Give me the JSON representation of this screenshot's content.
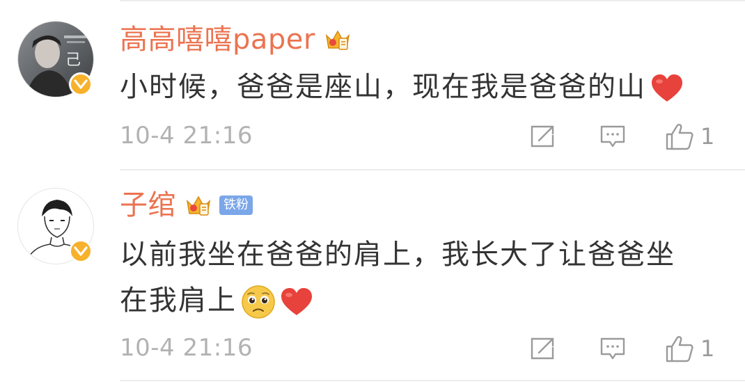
{
  "comments": [
    {
      "username": "高高嘻嘻paper",
      "badge": "",
      "text": "小时候，爸爸是座山，现在我是爸爸的山",
      "timestamp": "10-4 21:16",
      "like_count": "1",
      "emojis": [
        "heart-emoji"
      ]
    },
    {
      "username": "子绾",
      "badge": "铁粉",
      "text_line1": "以前我坐在爸爸的肩上，我长大了让爸爸坐",
      "text_line2": "在我肩上",
      "timestamp": "10-4 21:16",
      "like_count": "1",
      "emojis": [
        "pleading-face-emoji",
        "heart-emoji"
      ]
    }
  ],
  "icons": [
    "verified-icon",
    "crown-icon",
    "share-icon",
    "comment-icon",
    "like-icon"
  ],
  "colors": {
    "username": "#eb7350",
    "text": "#333333",
    "meta": "#b2b2b2",
    "verified": "#f7b12b",
    "fan_badge": "#7ba6e8",
    "heart": "#e8423c"
  }
}
